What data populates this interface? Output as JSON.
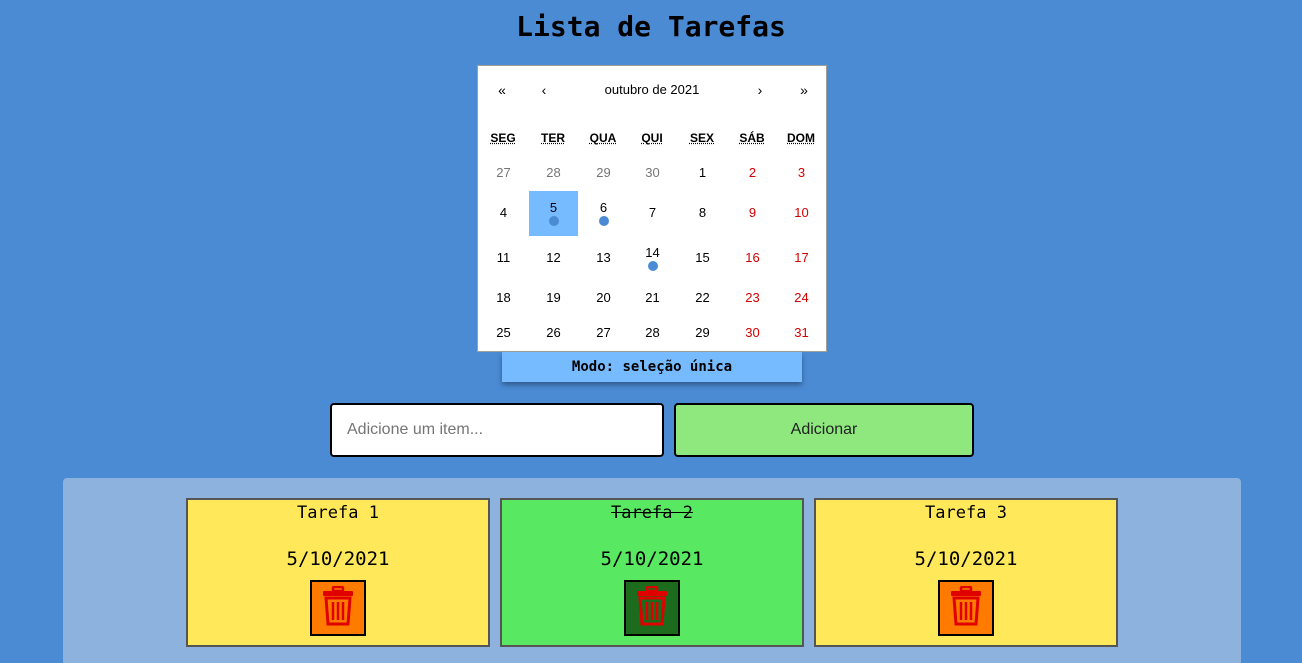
{
  "title": "Lista de Tarefas",
  "calendar": {
    "nav": {
      "prev_year": "«",
      "prev_month": "‹",
      "label": "outubro de 2021",
      "next_month": "›",
      "next_year": "»"
    },
    "weekdays": [
      "SEG",
      "TER",
      "QUA",
      "QUI",
      "SEX",
      "SÁB",
      "DOM"
    ],
    "weeks": [
      [
        {
          "day": "27",
          "neighbor": true
        },
        {
          "day": "28",
          "neighbor": true
        },
        {
          "day": "29",
          "neighbor": true
        },
        {
          "day": "30",
          "neighbor": true
        },
        {
          "day": "1"
        },
        {
          "day": "2",
          "weekend": true
        },
        {
          "day": "3",
          "weekend": true
        }
      ],
      [
        {
          "day": "4"
        },
        {
          "day": "5",
          "selected": true,
          "task_marker": true
        },
        {
          "day": "6",
          "task_marker": true
        },
        {
          "day": "7"
        },
        {
          "day": "8"
        },
        {
          "day": "9",
          "weekend": true
        },
        {
          "day": "10",
          "weekend": true
        }
      ],
      [
        {
          "day": "11"
        },
        {
          "day": "12"
        },
        {
          "day": "13"
        },
        {
          "day": "14",
          "task_marker": true
        },
        {
          "day": "15"
        },
        {
          "day": "16",
          "weekend": true
        },
        {
          "day": "17",
          "weekend": true
        }
      ],
      [
        {
          "day": "18"
        },
        {
          "day": "19"
        },
        {
          "day": "20"
        },
        {
          "day": "21"
        },
        {
          "day": "22"
        },
        {
          "day": "23",
          "weekend": true
        },
        {
          "day": "24",
          "weekend": true
        }
      ],
      [
        {
          "day": "25"
        },
        {
          "day": "26"
        },
        {
          "day": "27"
        },
        {
          "day": "28"
        },
        {
          "day": "29"
        },
        {
          "day": "30",
          "weekend": true
        },
        {
          "day": "31",
          "weekend": true
        }
      ]
    ]
  },
  "mode_label": "Modo: seleção única",
  "add_form": {
    "placeholder": "Adicione um item...",
    "button_label": "Adicionar"
  },
  "tasks": [
    {
      "name": "Tarefa 1",
      "date": "5/10/2021",
      "done": false,
      "delete_icon": "trash-icon"
    },
    {
      "name": "Tarefa 2",
      "date": "5/10/2021",
      "done": true,
      "delete_icon": "trash-icon"
    },
    {
      "name": "Tarefa 3",
      "date": "5/10/2021",
      "done": false,
      "delete_icon": "trash-icon"
    }
  ],
  "colors": {
    "background": "#4a8bd4",
    "selected_day": "#76baff",
    "weekend_text": "#d10000",
    "task_pending": "#ffe95a",
    "task_done": "#58e862",
    "add_button": "#8ee87e",
    "trash_pending_bg": "#ff7b00",
    "trash_done_bg": "#1d6b1d",
    "trash_icon": "#e00000"
  }
}
